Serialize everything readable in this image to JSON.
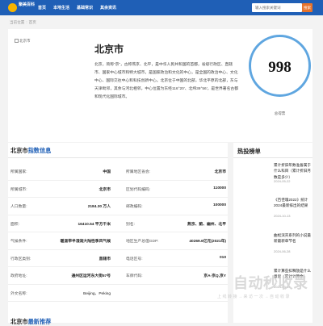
{
  "header": {
    "logo_text": "聚美百科",
    "nav": [
      "首页",
      "本地生活",
      "基础常识",
      "其余资讯"
    ],
    "search_placeholder": "输入搜索关键词",
    "search_button": "搜索"
  },
  "breadcrumb": {
    "home": "当前位置",
    "separator": ":",
    "current": "首页"
  },
  "hero": {
    "image_alt": "北京市",
    "title": "北京市",
    "description": "北京，简称“京”，古称燕京、北平，是中华人民共和国的首都，省级行政区、直辖市、国家中心城市和特大城市，是国家政治和文化的中心，是全国的政治中心、文化中心、国际交往中心和科技创新中心。北京位于中国的北部，华北平原的北部，东与天津毗邻，其余与河北相邻，中心位置为东经116°20′、北纬39°56′，是世界著名古都和现代化国际城市。",
    "count": "998",
    "count_caption": "总得票"
  },
  "info": {
    "title_prefix": "北京市",
    "title_highlight": "指数信息",
    "rows": [
      {
        "l1": "所属国家:",
        "v1": "中国",
        "l2": "所属地区省会:",
        "v2": "北京市"
      },
      {
        "l1": "所属城市:",
        "v1": "北京市",
        "l2": "区划代码编码:",
        "v2": "110000"
      },
      {
        "l1": "人口数量:",
        "v1": "2184.30 万人",
        "l2": "邮政编码:",
        "v2": "100000"
      },
      {
        "l1": "面积:",
        "v1": "16410.54 平方千米",
        "l2": "别名:",
        "v2": "燕京、蓟、幽州、北平"
      },
      {
        "l1": "气候条件:",
        "v1": "暖温带半湿润大陆性季风气候",
        "l2": "地区生产总值GDP:",
        "v2": "40269.6亿元(2021年)"
      },
      {
        "l1": "行政区类别:",
        "v1": "直辖市",
        "l2": "电话区号:",
        "v2": "010"
      },
      {
        "l1": "政府地址:",
        "v1": "通州区运河东大街57号",
        "l2": "车牌代码:",
        "v2": "京A-京Q,京Y"
      },
      {
        "l1": "外文名称:",
        "v1": "Beijing、Peking",
        "l2": "",
        "v2": ""
      }
    ],
    "next_prefix": "北京市",
    "next_highlight": "最新推荐"
  },
  "hot": {
    "title": "热投榜单",
    "items": [
      {
        "text": "累计折旧年数准备属于什么科目（累计折旧月数是多少）",
        "date": "2024-05-22"
      },
      {
        "text": "《百佳魂2022》统计2024最新排出的结果",
        "date": "2024-10-13"
      },
      {
        "text": "曲松滨壳系列的小说最新最新章节名",
        "date": "2024-06-28"
      },
      {
        "text": "累计算些扣释放是什么意思（累计计算余）",
        "date": "2024-03-14"
      }
    ]
  },
  "watermark": {
    "main": "自动秒收录",
    "sub": "上线转接→来访一次→自动收录"
  }
}
